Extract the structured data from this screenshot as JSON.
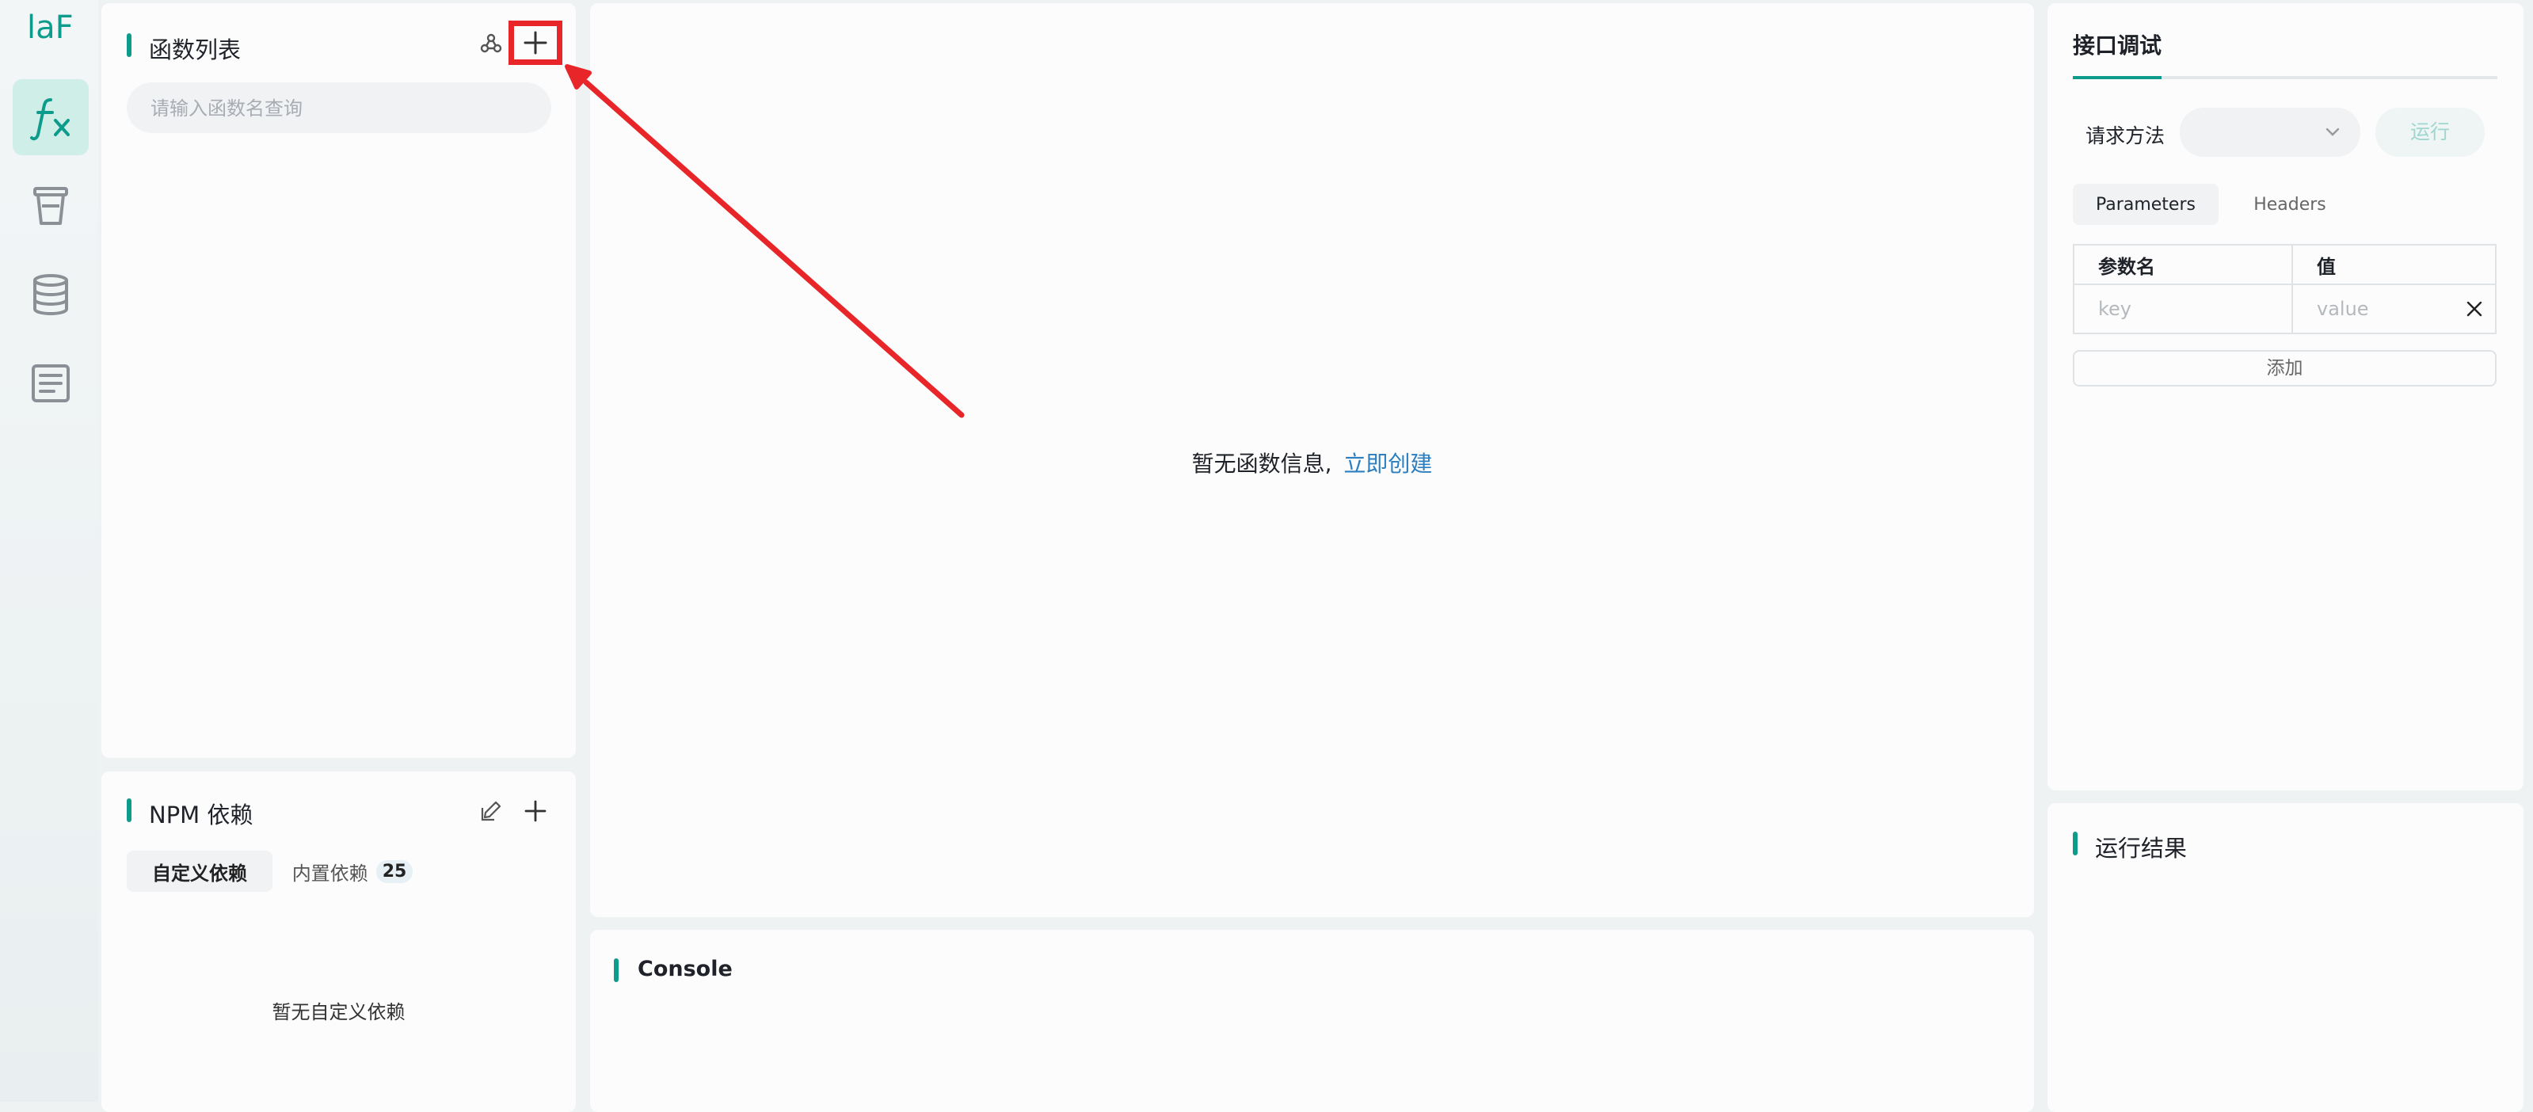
{
  "app": {
    "logo_text": "laF",
    "accent_color": "#0d9c8c",
    "annotation_color": "#e8262a"
  },
  "nav": {
    "items": [
      {
        "icon": "function-icon",
        "active": true
      },
      {
        "icon": "storage-icon",
        "active": false
      },
      {
        "icon": "database-icon",
        "active": false
      },
      {
        "icon": "logs-icon",
        "active": false
      }
    ]
  },
  "functions": {
    "title": "函数列表",
    "search_placeholder": "请输入函数名查询"
  },
  "npm": {
    "title": "NPM 依赖",
    "tabs": [
      {
        "label": "自定义依赖",
        "active": true
      },
      {
        "label": "内置依赖",
        "count": "25",
        "active": false
      }
    ],
    "empty_text": "暂无自定义依赖"
  },
  "editor": {
    "empty_text": "暂无函数信息,",
    "create_link": "立即创建"
  },
  "console": {
    "title": "Console"
  },
  "debug": {
    "tab_title": "接口调试",
    "method_label": "请求方法",
    "method_value": "",
    "run_label": "运行",
    "subtabs": [
      {
        "label": "Parameters",
        "active": true
      },
      {
        "label": "Headers",
        "active": false
      }
    ],
    "table": {
      "headers": [
        "参数名",
        "值"
      ],
      "key_placeholder": "key",
      "value_placeholder": "value"
    },
    "add_label": "添加"
  },
  "result": {
    "title": "运行结果"
  }
}
